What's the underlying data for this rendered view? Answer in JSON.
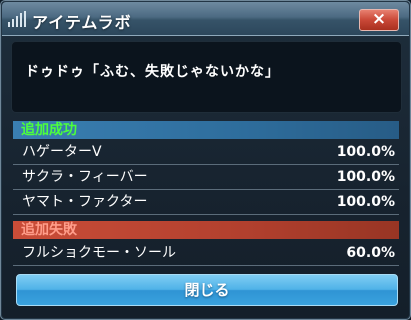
{
  "window": {
    "title": "アイテムラボ",
    "close_icon": "×"
  },
  "message": {
    "text": "ドゥドゥ「ふむ、失敗じゃないかな」"
  },
  "success": {
    "header": "追加成功",
    "items": [
      {
        "name": "ハゲーターV",
        "value": "100.0%"
      },
      {
        "name": "サクラ・フィーバー",
        "value": "100.0%"
      },
      {
        "name": "ヤマト・ファクター",
        "value": "100.0%"
      }
    ]
  },
  "failure": {
    "header": "追加失敗",
    "items": [
      {
        "name": "フルショクモー・ソール",
        "value": "60.0%"
      }
    ]
  },
  "footer": {
    "close_label": "閉じる"
  },
  "colors": {
    "success_text": "#4cff3c",
    "failure_text": "#ff9d8a",
    "close_button": "#4fb2e8",
    "title_close_button": "#c94837"
  }
}
